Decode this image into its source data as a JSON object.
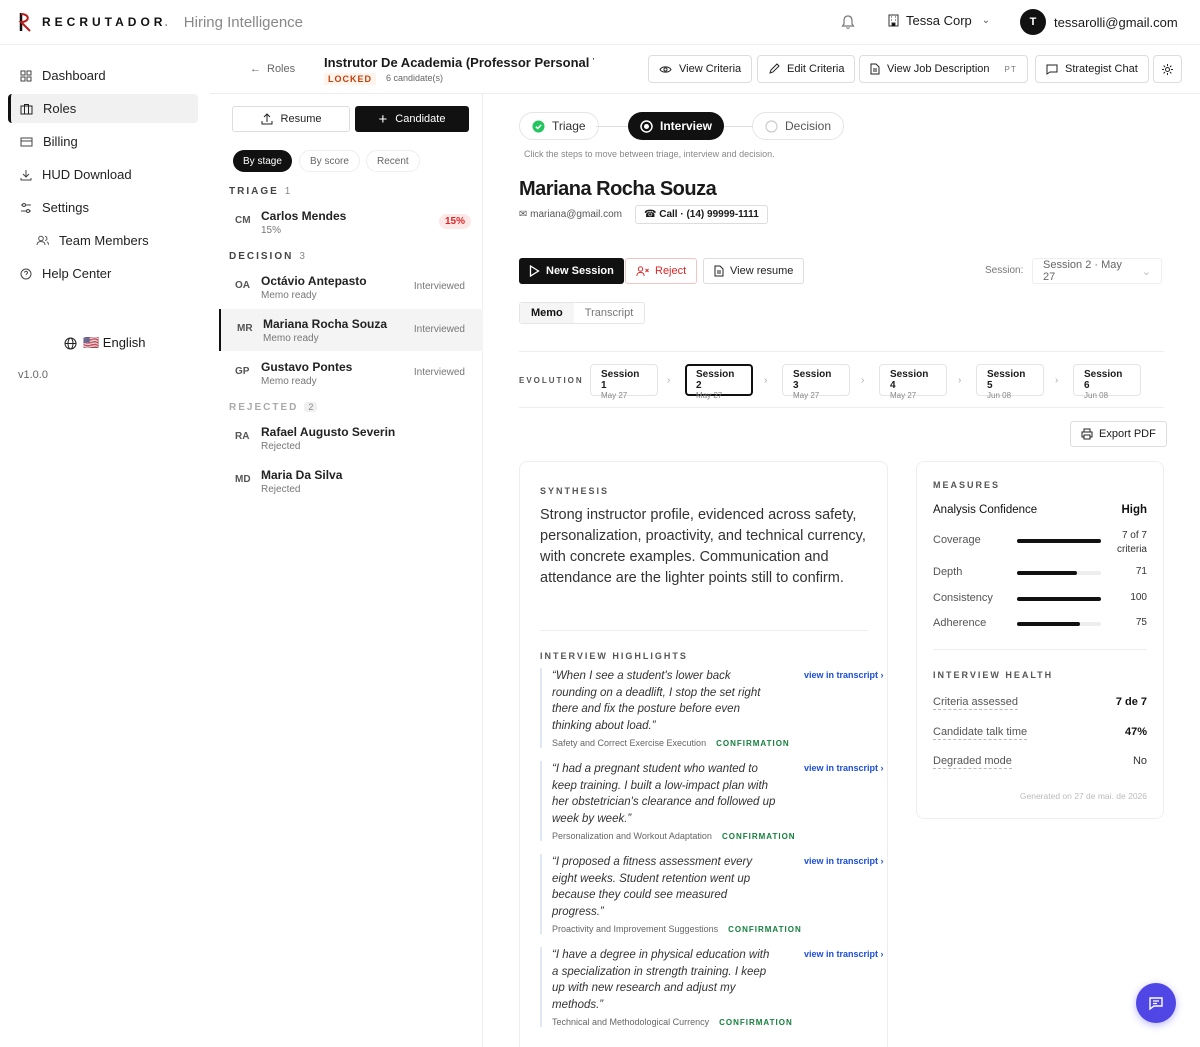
{
  "brand": {
    "name": "RECRUTADOR",
    "dot": ".",
    "tagline": "Hiring Intelligence"
  },
  "topbar": {
    "org": "Tessa Corp",
    "user_initial": "T",
    "user_email": "tessarolli@gmail.com"
  },
  "sidebar": {
    "items": [
      {
        "label": "Dashboard",
        "icon": "grid-icon"
      },
      {
        "label": "Roles",
        "icon": "briefcase-icon"
      },
      {
        "label": "Billing",
        "icon": "card-icon"
      },
      {
        "label": "HUD Download",
        "icon": "download-icon"
      },
      {
        "label": "Settings",
        "icon": "sliders-icon"
      },
      {
        "label": "Team Members",
        "icon": "users-icon"
      },
      {
        "label": "Help Center",
        "icon": "help-icon"
      }
    ],
    "language": "🇺🇸 English",
    "version": "v1.0.0"
  },
  "subheader": {
    "back_label": "Roles",
    "role_title": "Instrutor De Academia (Professor Personal T...",
    "locked": "LOCKED",
    "candidates": "6 candidate(s)",
    "buttons": {
      "view_criteria": "View Criteria",
      "edit_criteria": "Edit Criteria",
      "view_jd": "View Job Description",
      "pt": "PT",
      "strategist": "Strategist Chat"
    }
  },
  "list": {
    "resume_btn": "Resume",
    "candidate_btn": "Candidate",
    "sort": [
      "By stage",
      "By score",
      "Recent"
    ],
    "groups": {
      "triage": {
        "label": "TRIAGE",
        "count": "1"
      },
      "decision": {
        "label": "DECISION",
        "count": "3"
      },
      "rejected": {
        "label": "REJECTED",
        "count": "2"
      }
    },
    "candidates": [
      {
        "initials": "CM",
        "name": "Carlos Mendes",
        "status": "15%",
        "tag": "15%"
      },
      {
        "initials": "OA",
        "name": "Octávio Antepasto",
        "status": "Memo ready",
        "tag": "Interviewed"
      },
      {
        "initials": "MR",
        "name": "Mariana Rocha Souza",
        "status": "Memo ready",
        "tag": "Interviewed"
      },
      {
        "initials": "GP",
        "name": "Gustavo Pontes",
        "status": "Memo ready",
        "tag": "Interviewed"
      },
      {
        "initials": "RA",
        "name": "Rafael Augusto Severin",
        "status": "Rejected",
        "tag": ""
      },
      {
        "initials": "MD",
        "name": "Maria Da Silva",
        "status": "Rejected",
        "tag": ""
      }
    ]
  },
  "main": {
    "steps": [
      "Triage",
      "Interview",
      "Decision"
    ],
    "hint": "Click the steps to move between triage, interview and decision.",
    "candidate_name": "Mariana Rocha Souza",
    "email": "✉ mariana@gmail.com",
    "call": "☎ Call · (14) 99999-1111",
    "actions": {
      "new_session": "New Session",
      "reject": "Reject",
      "view_resume": "View resume"
    },
    "session_label": "Session:",
    "session_value": "Session 2 · May 27",
    "tabs": [
      "Memo",
      "Transcript"
    ],
    "evolution_label": "EVOLUTION",
    "sessions": [
      {
        "title": "Session 1",
        "date": "May 27"
      },
      {
        "title": "Session 2",
        "date": "May 27"
      },
      {
        "title": "Session 3",
        "date": "May 27"
      },
      {
        "title": "Session 4",
        "date": "May 27"
      },
      {
        "title": "Session 5",
        "date": "Jun 08"
      },
      {
        "title": "Session 6",
        "date": "Jun 08"
      }
    ],
    "export": "Export PDF",
    "synthesis_h": "SYNTHESIS",
    "synthesis": "Strong instructor profile, evidenced across safety, personalization, proactivity, and technical currency, with concrete examples. Communication and attendance are the lighter points still to confirm.",
    "highlights_h": "INTERVIEW HIGHLIGHTS",
    "link_label": "view in transcript ›",
    "highlights": [
      {
        "quote": "“When I see a student's lower back rounding on a deadlift, I stop the set right there and fix the posture before even thinking about load.”",
        "criterion": "Safety and Correct Exercise Execution",
        "tag": "CONFIRMATION"
      },
      {
        "quote": "“I had a pregnant student who wanted to keep training. I built a low-impact plan with her obstetrician's clearance and followed up week by week.”",
        "criterion": "Personalization and Workout Adaptation",
        "tag": "CONFIRMATION"
      },
      {
        "quote": "“I proposed a fitness assessment every eight weeks. Student retention went up because they could see measured progress.”",
        "criterion": "Proactivity and Improvement Suggestions",
        "tag": "CONFIRMATION"
      },
      {
        "quote": "“I have a degree in physical education with a specialization in strength training. I keep up with new research and adjust my methods.”",
        "criterion": "Technical and Methodological Currency",
        "tag": "CONFIRMATION"
      }
    ],
    "measures": {
      "title": "MEASURES",
      "confidence_label": "Analysis Confidence",
      "confidence_value": "High",
      "rows": [
        {
          "label": "Coverage",
          "value": "7 of 7 criteria",
          "fill": 1.0
        },
        {
          "label": "Depth",
          "value": "71",
          "fill": 0.71
        },
        {
          "label": "Consistency",
          "value": "100",
          "fill": 1.0
        },
        {
          "label": "Adherence",
          "value": "75",
          "fill": 0.75
        }
      ]
    },
    "health": {
      "title": "INTERVIEW HEALTH",
      "rows": [
        {
          "label": "Criteria assessed",
          "value": "7 de 7"
        },
        {
          "label": "Candidate talk time",
          "value": "47%"
        },
        {
          "label": "Degraded mode",
          "value": "No"
        }
      ],
      "generated": "Generated on 27 de mai. de 2026"
    }
  }
}
